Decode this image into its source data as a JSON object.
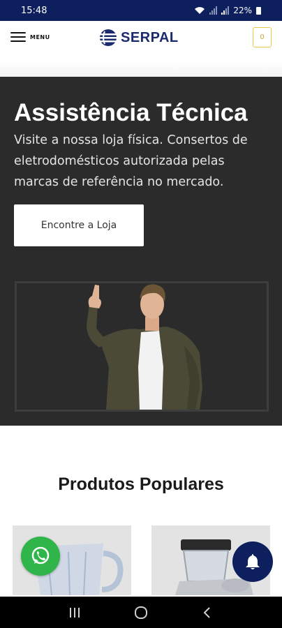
{
  "status_bar": {
    "time": "15:48",
    "battery": "22%"
  },
  "header": {
    "menu_label": "MENU",
    "logo_text": "SERPAL",
    "cart_count": "0"
  },
  "hero": {
    "title": "Assistência Técnica",
    "description": "Visite a nossa loja física. Consertos de eletrodomésticos autorizada pelas marcas de referência no mercado.",
    "button_label": "Encontre a Loja",
    "image_icon": "man-pointing-up-photo"
  },
  "products": {
    "section_title": "Produtos Populares",
    "items": [
      {
        "image_icon": "blender-jug-photo"
      },
      {
        "image_icon": "juicer-photo"
      }
    ]
  },
  "floating": {
    "whatsapp_icon": "whatsapp-icon",
    "notification_icon": "bell-icon"
  },
  "nav_bar": {
    "items": [
      "recent-apps-icon",
      "home-icon",
      "back-icon"
    ]
  },
  "colors": {
    "brand_navy": "#0d1f5c",
    "hero_bg": "#2b2b2b",
    "cart_gold": "#e8c74a",
    "whatsapp_green": "#2fb54a"
  }
}
